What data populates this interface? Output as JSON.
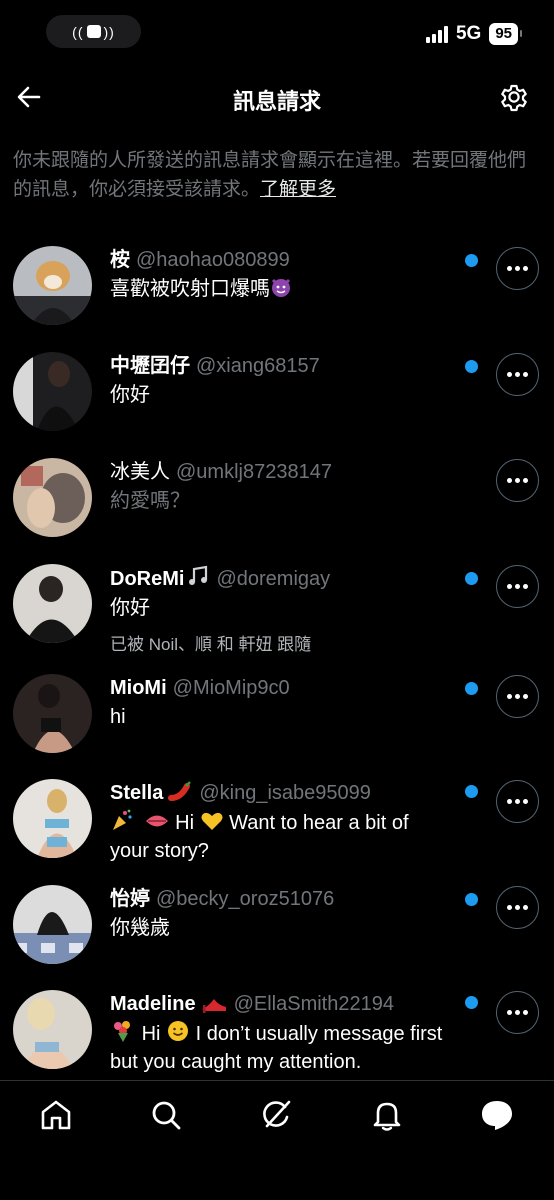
{
  "status_bar": {
    "network": "5G",
    "battery": "95"
  },
  "header": {
    "title": "訊息請求"
  },
  "info": {
    "text": "你未跟隨的人所發送的訊息請求會顯示在這裡。若要回覆他們的訊息，你必須接受該請求。",
    "link": "了解更多"
  },
  "requests": [
    {
      "name": "桉",
      "handle": "@haohao080899",
      "message": "喜歡被吹射口爆嗎",
      "message_emoji": "smiling-devil-emoji",
      "unread": true
    },
    {
      "name": "中壢囝仔",
      "handle": "@xiang68157",
      "message": "你好",
      "unread": true
    },
    {
      "name": "冰美人",
      "handle": "@umklj87238147",
      "message": "約愛嗎？",
      "unread": false
    },
    {
      "name": "DoReMi",
      "name_emoji": "music-note-emoji",
      "handle": "@doremigay",
      "message": "你好",
      "followed_by": "已被 Noil、順 和 軒妞 跟隨",
      "unread": true
    },
    {
      "name": "MioMi",
      "handle": "@MioMip9c0",
      "message": "hi",
      "unread": true
    },
    {
      "name": "Stella",
      "name_emoji": "chili-pepper-emoji",
      "handle": "@king_isabe95099",
      "message_line1": "Hi",
      "message_line1b": "Want to hear a bit of",
      "message_line2": "your story?",
      "unread": true
    },
    {
      "name": "怡婷",
      "handle": "@becky_oroz51076",
      "message": "你幾歲",
      "unread": true
    },
    {
      "name": "Madeline",
      "name_emoji": "high-heel-emoji",
      "handle": "@EllaSmith22194",
      "message_line1": "Hi",
      "message_line1b": "I don’t usually message first",
      "message_line2": "but you caught my attention.",
      "unread": true
    }
  ],
  "tabs": [
    "home-icon",
    "search-icon",
    "grok-icon",
    "notifications-icon",
    "messages-icon"
  ],
  "colors": {
    "accent": "#1d9bf0",
    "background": "#000000",
    "secondary_text": "#71767b"
  }
}
